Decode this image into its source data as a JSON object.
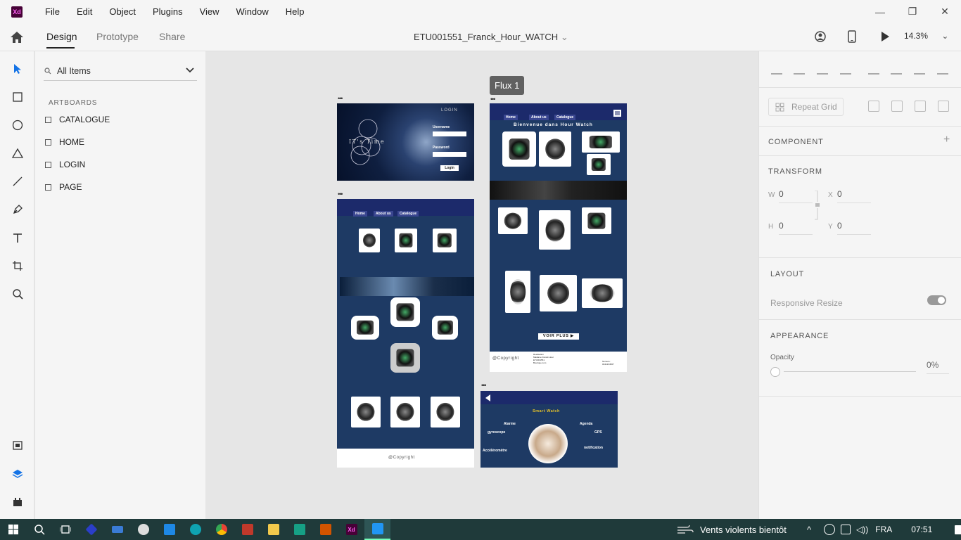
{
  "app": {
    "logo": "Xd"
  },
  "menu": [
    "File",
    "Edit",
    "Object",
    "Plugins",
    "View",
    "Window",
    "Help"
  ],
  "window_controls": {
    "minimize": "—",
    "restore": "❐",
    "close": "✕"
  },
  "toolbar": {
    "modes": [
      "Design",
      "Prototype",
      "Share"
    ],
    "active_mode": "Design",
    "document_title": "ETU001551_Franck_Hour_WATCH",
    "zoom": "14.3%"
  },
  "tools": [
    "select-icon",
    "rectangle-icon",
    "ellipse-icon",
    "polygon-icon",
    "line-icon",
    "pen-icon",
    "text-icon",
    "artboard-icon",
    "zoom-icon"
  ],
  "rail_bottom": [
    "assets-icon",
    "layers-icon",
    "plugins-icon"
  ],
  "layers": {
    "search_value": "All Items",
    "section": "ARTBOARDS",
    "items": [
      "CATALOGUE",
      "HOME",
      "LOGIN",
      "PAGE"
    ]
  },
  "canvas": {
    "flow_label": "Flux 1",
    "dots": "•••",
    "login_board": {
      "title": "IT's Time",
      "heading": "LOGIN",
      "field1": "Username",
      "field2": "Password",
      "button": "Login"
    },
    "home_board": {
      "nav": [
        "Home",
        "About us",
        "Catalogue"
      ],
      "footer": "@Copyright"
    },
    "catalogue_board": {
      "nav": [
        "Home",
        "About us",
        "Catalogue"
      ],
      "welcome": "Bienvenue dans Hour Watch",
      "button": "VOIR PLUS ▶",
      "footer_left": "@Copyright",
      "footer_mid1": "Realisation",
      "footer_mid2": "Madame Franck Hour",
      "footer_mid3": "ETU001551",
      "footer_mid4": "Boutique.com",
      "footer_right1": "Numero :",
      "footer_right2": "0341234567"
    },
    "page_board": {
      "title": "Smart Watch",
      "features": [
        "Alarme",
        "Agenda",
        "gyroscope",
        "GPS",
        "Accéléromètre",
        "notification"
      ]
    }
  },
  "properties": {
    "repeat_grid": "Repeat Grid",
    "component": "COMPONENT",
    "transform": "TRANSFORM",
    "w_label": "W",
    "w": "0",
    "x_label": "X",
    "x": "0",
    "h_label": "H",
    "h": "0",
    "y_label": "Y",
    "y": "0",
    "layout": "LAYOUT",
    "responsive": "Responsive Resize",
    "appearance": "APPEARANCE",
    "opacity_label": "Opacity",
    "opacity": "0%"
  },
  "taskbar": {
    "weather": "Vents violents bientôt",
    "lang": "FRA",
    "time": "07:51"
  },
  "colors": {
    "accent": "#1473e6",
    "navy": "#1e3a64",
    "taskbar": "#1f3a3a"
  }
}
